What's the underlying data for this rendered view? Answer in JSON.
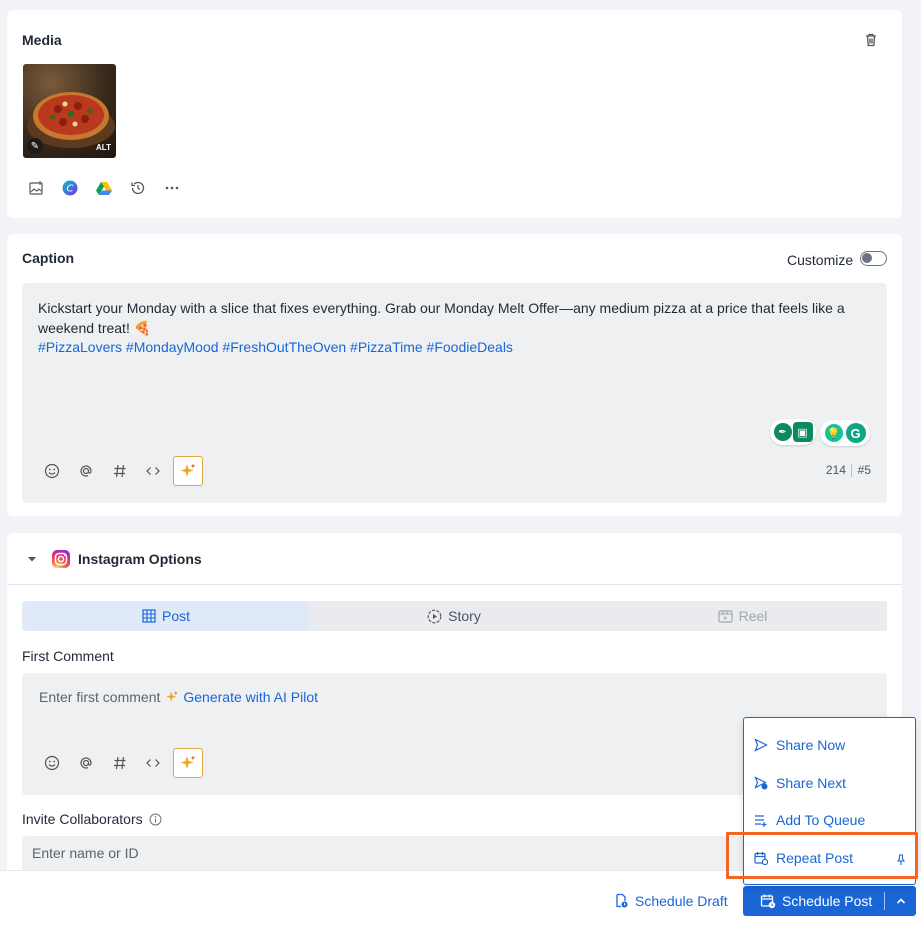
{
  "media": {
    "title": "Media",
    "alt_badge": "ALT",
    "image_description_icon": "pizza-thumbnail",
    "tools": [
      "image-upload-icon",
      "canva-icon",
      "google-drive-icon",
      "history-icon",
      "more-icon"
    ]
  },
  "caption": {
    "title": "Caption",
    "customize_label": "Customize",
    "text": "Kickstart your Monday with a slice that fixes everything. Grab our Monday Melt Offer—any medium pizza at a price that feels like a weekend treat! 🍕",
    "hashtags": "#PizzaLovers #MondayMood #FreshOutTheOven #PizzaTime #FoodieDeals",
    "char_count": "214",
    "hashtag_count": "#5"
  },
  "instagram": {
    "title": "Instagram Options",
    "tabs": [
      {
        "label": "Post",
        "active": true
      },
      {
        "label": "Story",
        "active": false
      },
      {
        "label": "Reel",
        "active": false
      }
    ],
    "first_comment_label": "First Comment",
    "first_comment_placeholder": "Enter first comment",
    "generate_ai": "Generate with AI Pilot",
    "invite_label": "Invite Collaborators",
    "invite_placeholder": "Enter name or ID"
  },
  "menu": {
    "items": [
      {
        "label": "Share Now",
        "icon": "send-icon"
      },
      {
        "label": "Share Next",
        "icon": "send-clock-icon"
      },
      {
        "label": "Add To Queue",
        "icon": "queue-add-icon"
      },
      {
        "label": "Repeat Post",
        "icon": "calendar-repeat-icon"
      }
    ]
  },
  "footer": {
    "schedule_draft": "Schedule Draft",
    "schedule_post": "Schedule Post"
  },
  "colors": {
    "accent": "#1a66d6",
    "highlight": "#f26522",
    "ai": "#e08a00"
  }
}
